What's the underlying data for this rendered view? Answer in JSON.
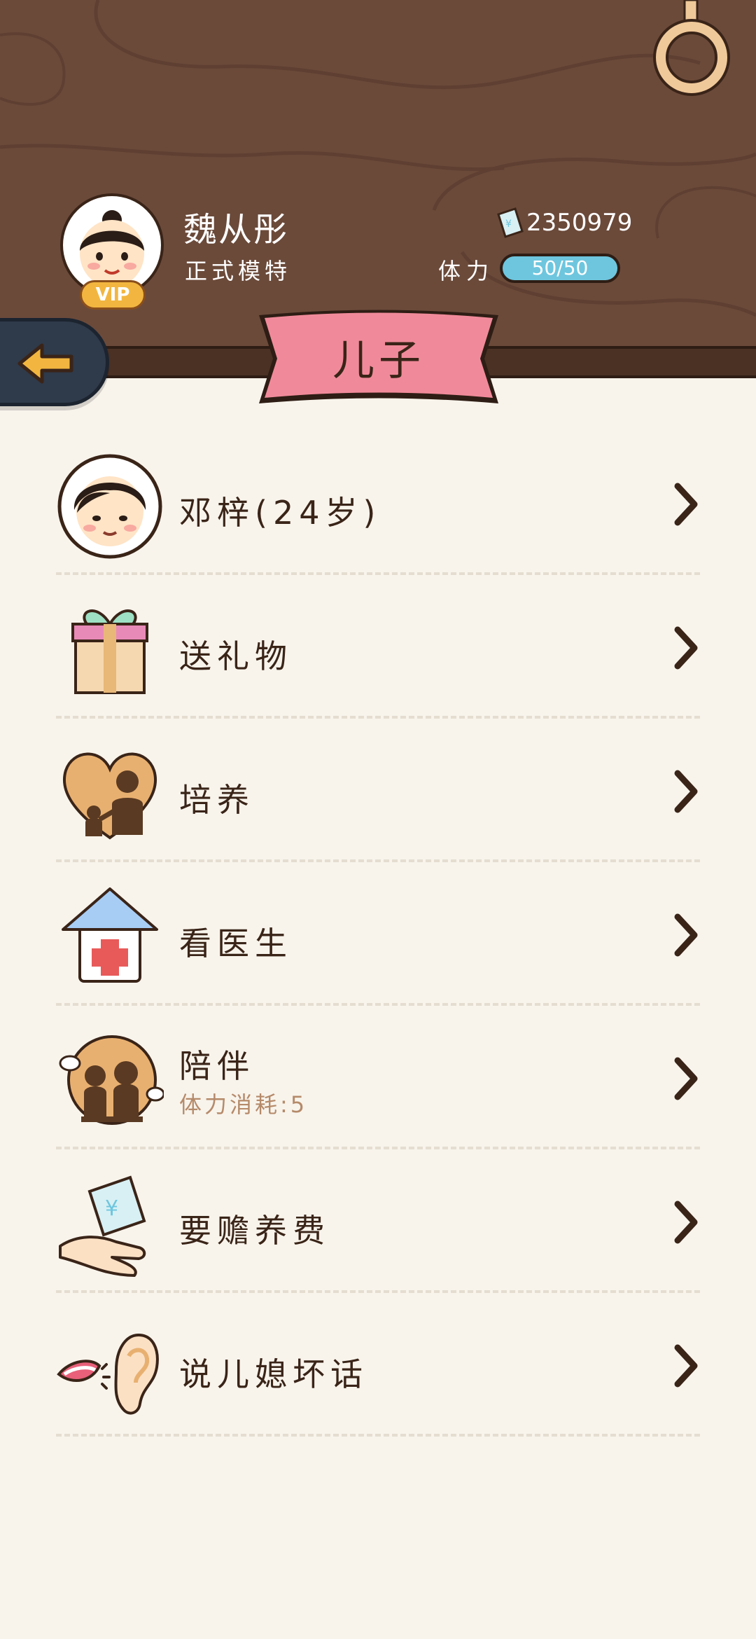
{
  "header": {
    "player_name": "魏从彤",
    "player_title": "正式模特",
    "vip_label": "VIP",
    "money": "2350979",
    "stamina_label": "体力",
    "stamina_value": "50/50"
  },
  "page_title": "儿子",
  "menu": [
    {
      "label": "邓梓(24岁)",
      "icon": "son-avatar-icon"
    },
    {
      "label": "送礼物",
      "icon": "gift-icon"
    },
    {
      "label": "培养",
      "icon": "heart-family-icon"
    },
    {
      "label": "看医生",
      "icon": "hospital-icon"
    },
    {
      "label": "陪伴",
      "sublabel": "体力消耗:5",
      "icon": "companion-icon"
    },
    {
      "label": "要赡养费",
      "icon": "money-hand-icon"
    },
    {
      "label": "说儿媳坏话",
      "icon": "gossip-icon"
    }
  ],
  "colors": {
    "header_wood": "#6b4a3a",
    "ribbon_pink": "#f08a9a",
    "stamina_bar": "#6ec6de",
    "back_button": "#2f3a4a",
    "background": "#f8f4ec"
  }
}
